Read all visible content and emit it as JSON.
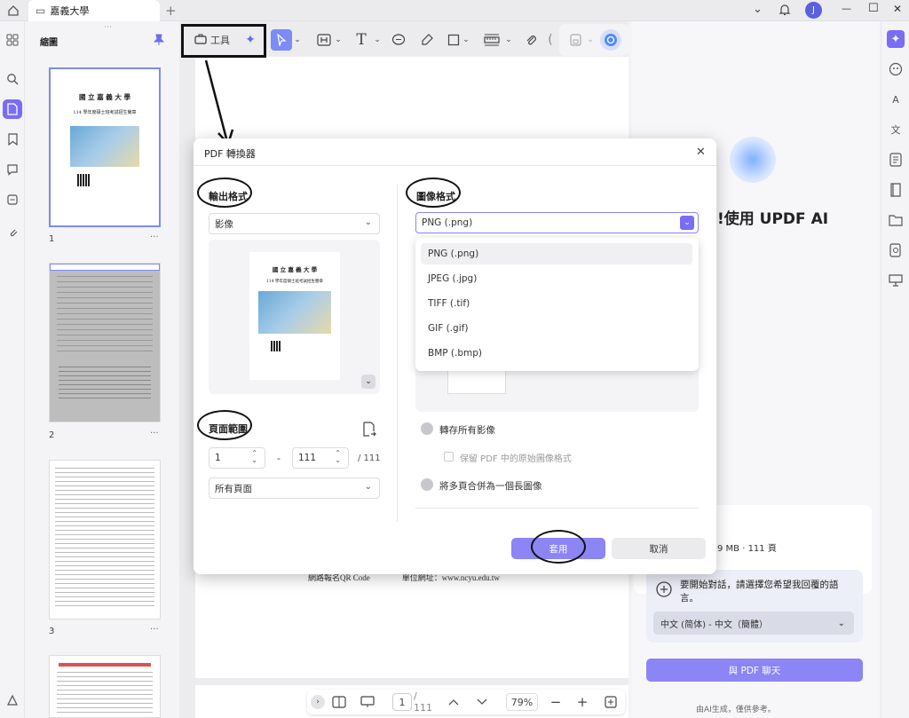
{
  "titlebar": {
    "tab_title": "嘉義大學",
    "new_tab": "+",
    "chevron": "⌄",
    "bell": "🔔",
    "avatar": "J",
    "minimize": "—",
    "maximize": "☐",
    "close": "✕"
  },
  "thumbs": {
    "panel_title": "縮圖",
    "pages": [
      "1",
      "2",
      "3"
    ],
    "more": "···",
    "p1_title": "國 立 嘉 義 大 學",
    "p1_subtitle": "114 學年度碩士班考試招生簡章"
  },
  "toolbar": {
    "tools_label": "工具"
  },
  "dialog": {
    "title": "PDF 轉換器",
    "output_format_title": "輸出格式",
    "output_format_value": "影像",
    "preview_title": "國 立 嘉 義 大 學",
    "preview_subtitle": "114 學年度碩士班考試招生簡章",
    "page_range_title": "頁面範圍",
    "range_from": "1",
    "range_dash": "-",
    "range_to": "111",
    "range_total": "/ 111",
    "page_subset": "所有頁面",
    "image_format_title": "圖像格式",
    "image_format_value": "PNG (.png)",
    "format_options": [
      "PNG (.png)",
      "JPEG (.jpg)",
      "TIFF (.tif)",
      "GIF (.gif)",
      "BMP (.bmp)"
    ],
    "convert_all_images": "轉存所有影像",
    "keep_original_format": "保留 PDF 中的原始圖像格式",
    "merge_pages": "將多頁合併為一個長圖像",
    "apply_button": "套用",
    "cancel_button": "取消"
  },
  "right_panel": {
    "heading": "!使用 UPDF AI",
    "file_info": "9 MB · 111 頁",
    "prompt": "要開始對話，請選擇您希望我回覆的語言。",
    "language": "中文 (简体) - 中文（簡體）",
    "chat_button": "與 PDF 聊天",
    "footer": "由AI生成，僅供參考。"
  },
  "doc": {
    "bottom_text": "網路報名QR Code　　　　單位網址：www.ncyu.edu.tw"
  },
  "bottomnav": {
    "page_current": "1",
    "page_total": "/ 111",
    "zoom": "79%",
    "minus": "−",
    "plus": "+"
  },
  "colors": {
    "accent": "#7b6cf6",
    "apply_button": "#8b85f5",
    "dropdown_chevron_bg": "#7b6cf6"
  }
}
